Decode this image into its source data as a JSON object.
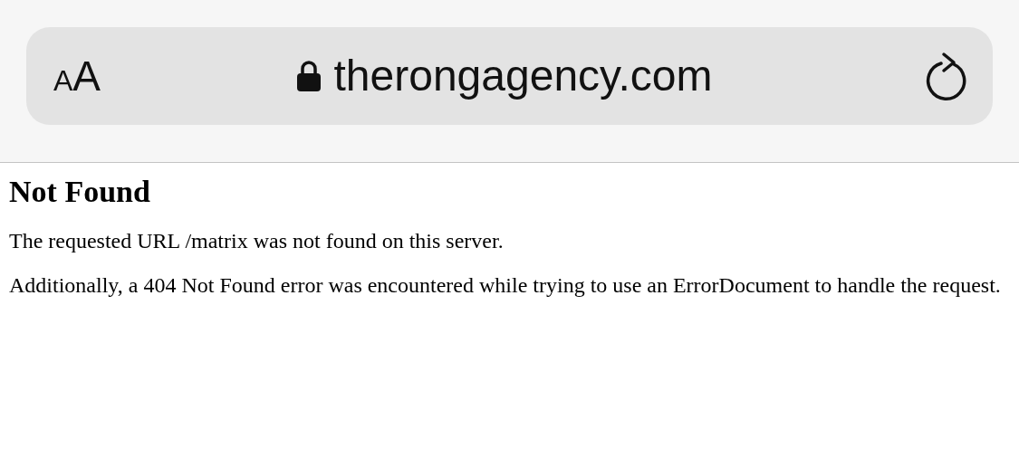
{
  "address_bar": {
    "text_size_button": "AA",
    "secure": true,
    "domain": "therongagency.com"
  },
  "page": {
    "heading": "Not Found",
    "paragraphs": [
      "The requested URL /matrix was not found on this server.",
      "Additionally, a 404 Not Found error was encountered while trying to use an ErrorDocument to handle the request."
    ]
  }
}
